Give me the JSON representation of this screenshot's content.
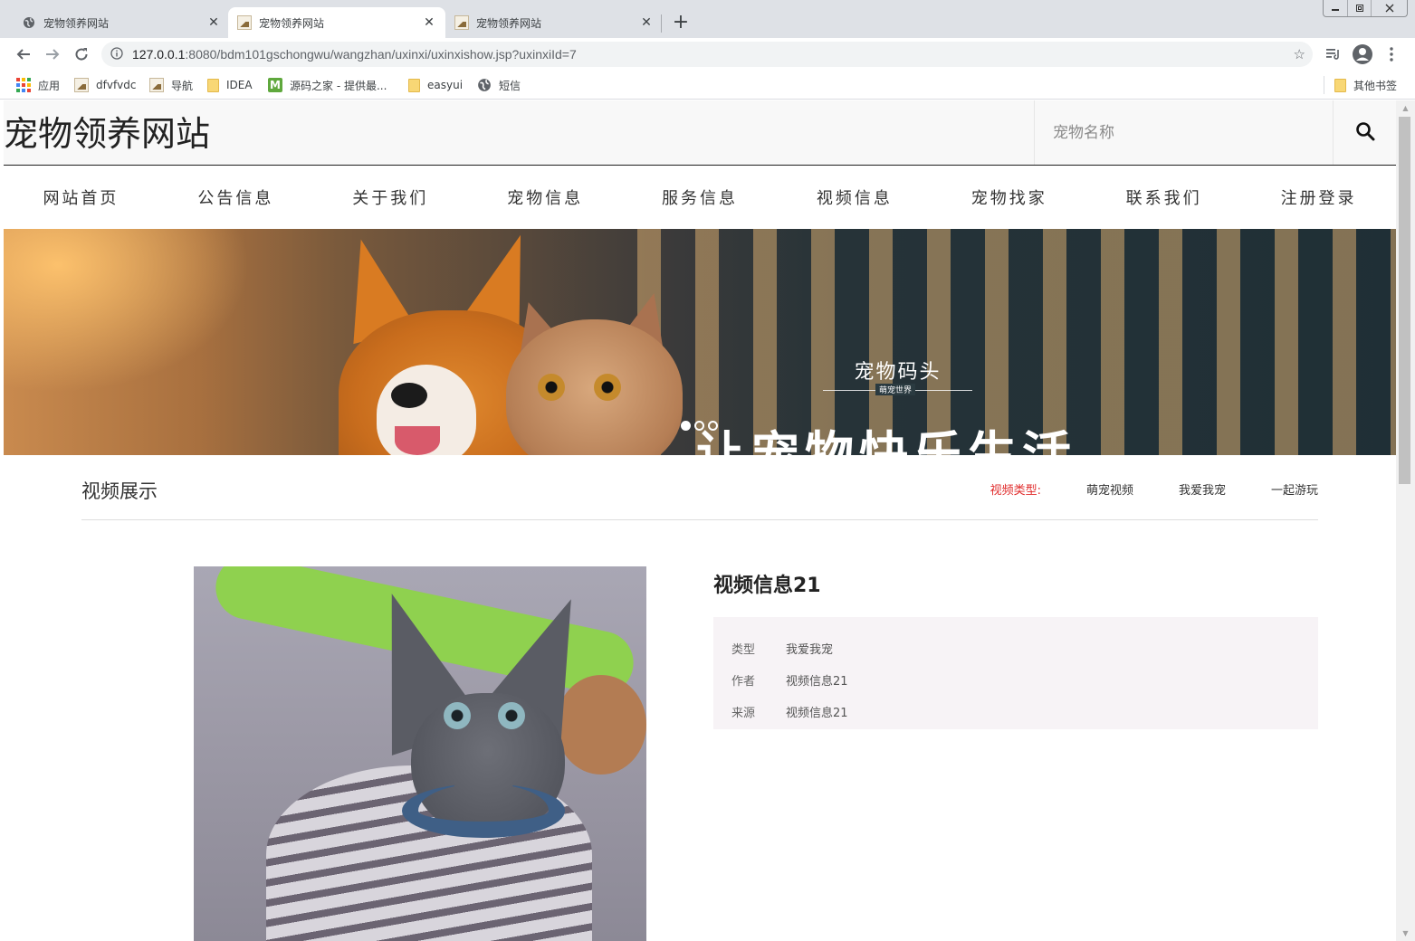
{
  "browser": {
    "tabs": [
      {
        "title": "宠物领养网站",
        "active": false
      },
      {
        "title": "宠物领养网站",
        "active": true
      },
      {
        "title": "宠物领养网站",
        "active": false
      }
    ],
    "new_tab": "+",
    "close_glyph": "✕",
    "url_host": "127.0.0.1",
    "url_rest": ":8080/bdm101gschongwu/wangzhan/uxinxi/uxinxishow.jsp?uxinxiId=7",
    "bookmarks": [
      {
        "label": "应用",
        "icon": "apps-grid-icon"
      },
      {
        "label": "dfvfvdc",
        "icon": "image-icon"
      },
      {
        "label": "导航",
        "icon": "image-icon"
      },
      {
        "label": "IDEA",
        "icon": "folder-icon"
      },
      {
        "label": "源码之家 - 提供最...",
        "icon": "m-logo-icon"
      },
      {
        "label": "easyui",
        "icon": "folder-icon"
      },
      {
        "label": "短信",
        "icon": "globe-icon"
      }
    ],
    "other_bookmarks": "其他书签"
  },
  "site": {
    "logo": "宠物领养网站",
    "search_placeholder": "宠物名称",
    "nav": [
      "网站首页",
      "公告信息",
      "关于我们",
      "宠物信息",
      "服务信息",
      "视频信息",
      "宠物找家",
      "联系我们",
      "注册登录"
    ],
    "banner": {
      "brand": "宠物码头",
      "brand_sub": "萌宠世界",
      "slogan": "让宠物快乐生活"
    },
    "section": {
      "title": "视频展示",
      "category_label": "视频类型:",
      "categories": [
        "萌宠视频",
        "我爱我宠",
        "一起游玩"
      ]
    },
    "detail": {
      "title": "视频信息21",
      "rows": [
        {
          "key": "类型",
          "value": "我爱我宠"
        },
        {
          "key": "作者",
          "value": "视频信息21"
        },
        {
          "key": "来源",
          "value": "视频信息21"
        }
      ]
    }
  },
  "colors": {
    "accent_red": "#e02a2a",
    "chrome_bg": "#dee1e6",
    "info_box_bg": "#f7f3f6"
  }
}
